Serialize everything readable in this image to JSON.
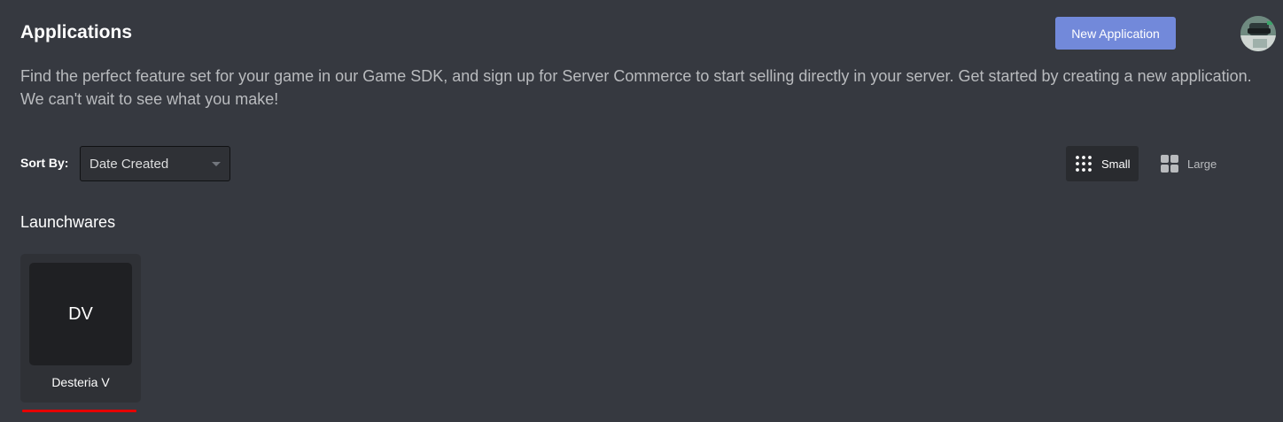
{
  "header": {
    "title": "Applications",
    "new_app_label": "New Application",
    "description": "Find the perfect feature set for your game in our Game SDK, and sign up for Server Commerce to start selling directly in your server. Get started by creating a new application. We can't wait to see what you make!"
  },
  "sort": {
    "label": "Sort By:",
    "selected": "Date Created"
  },
  "view": {
    "small_label": "Small",
    "large_label": "Large",
    "active": "Small"
  },
  "team": {
    "name": "Launchwares",
    "apps": [
      {
        "initials": "DV",
        "name": "Desteria V"
      }
    ]
  },
  "colors": {
    "background": "#363940",
    "accent": "#7289da",
    "card": "#2f3136",
    "underline": "#e60000"
  },
  "icons": {
    "avatar": "user-avatar",
    "sort_chevron": "chevron-down-icon",
    "small_view": "dots-grid-icon",
    "large_view": "squares-grid-icon"
  }
}
